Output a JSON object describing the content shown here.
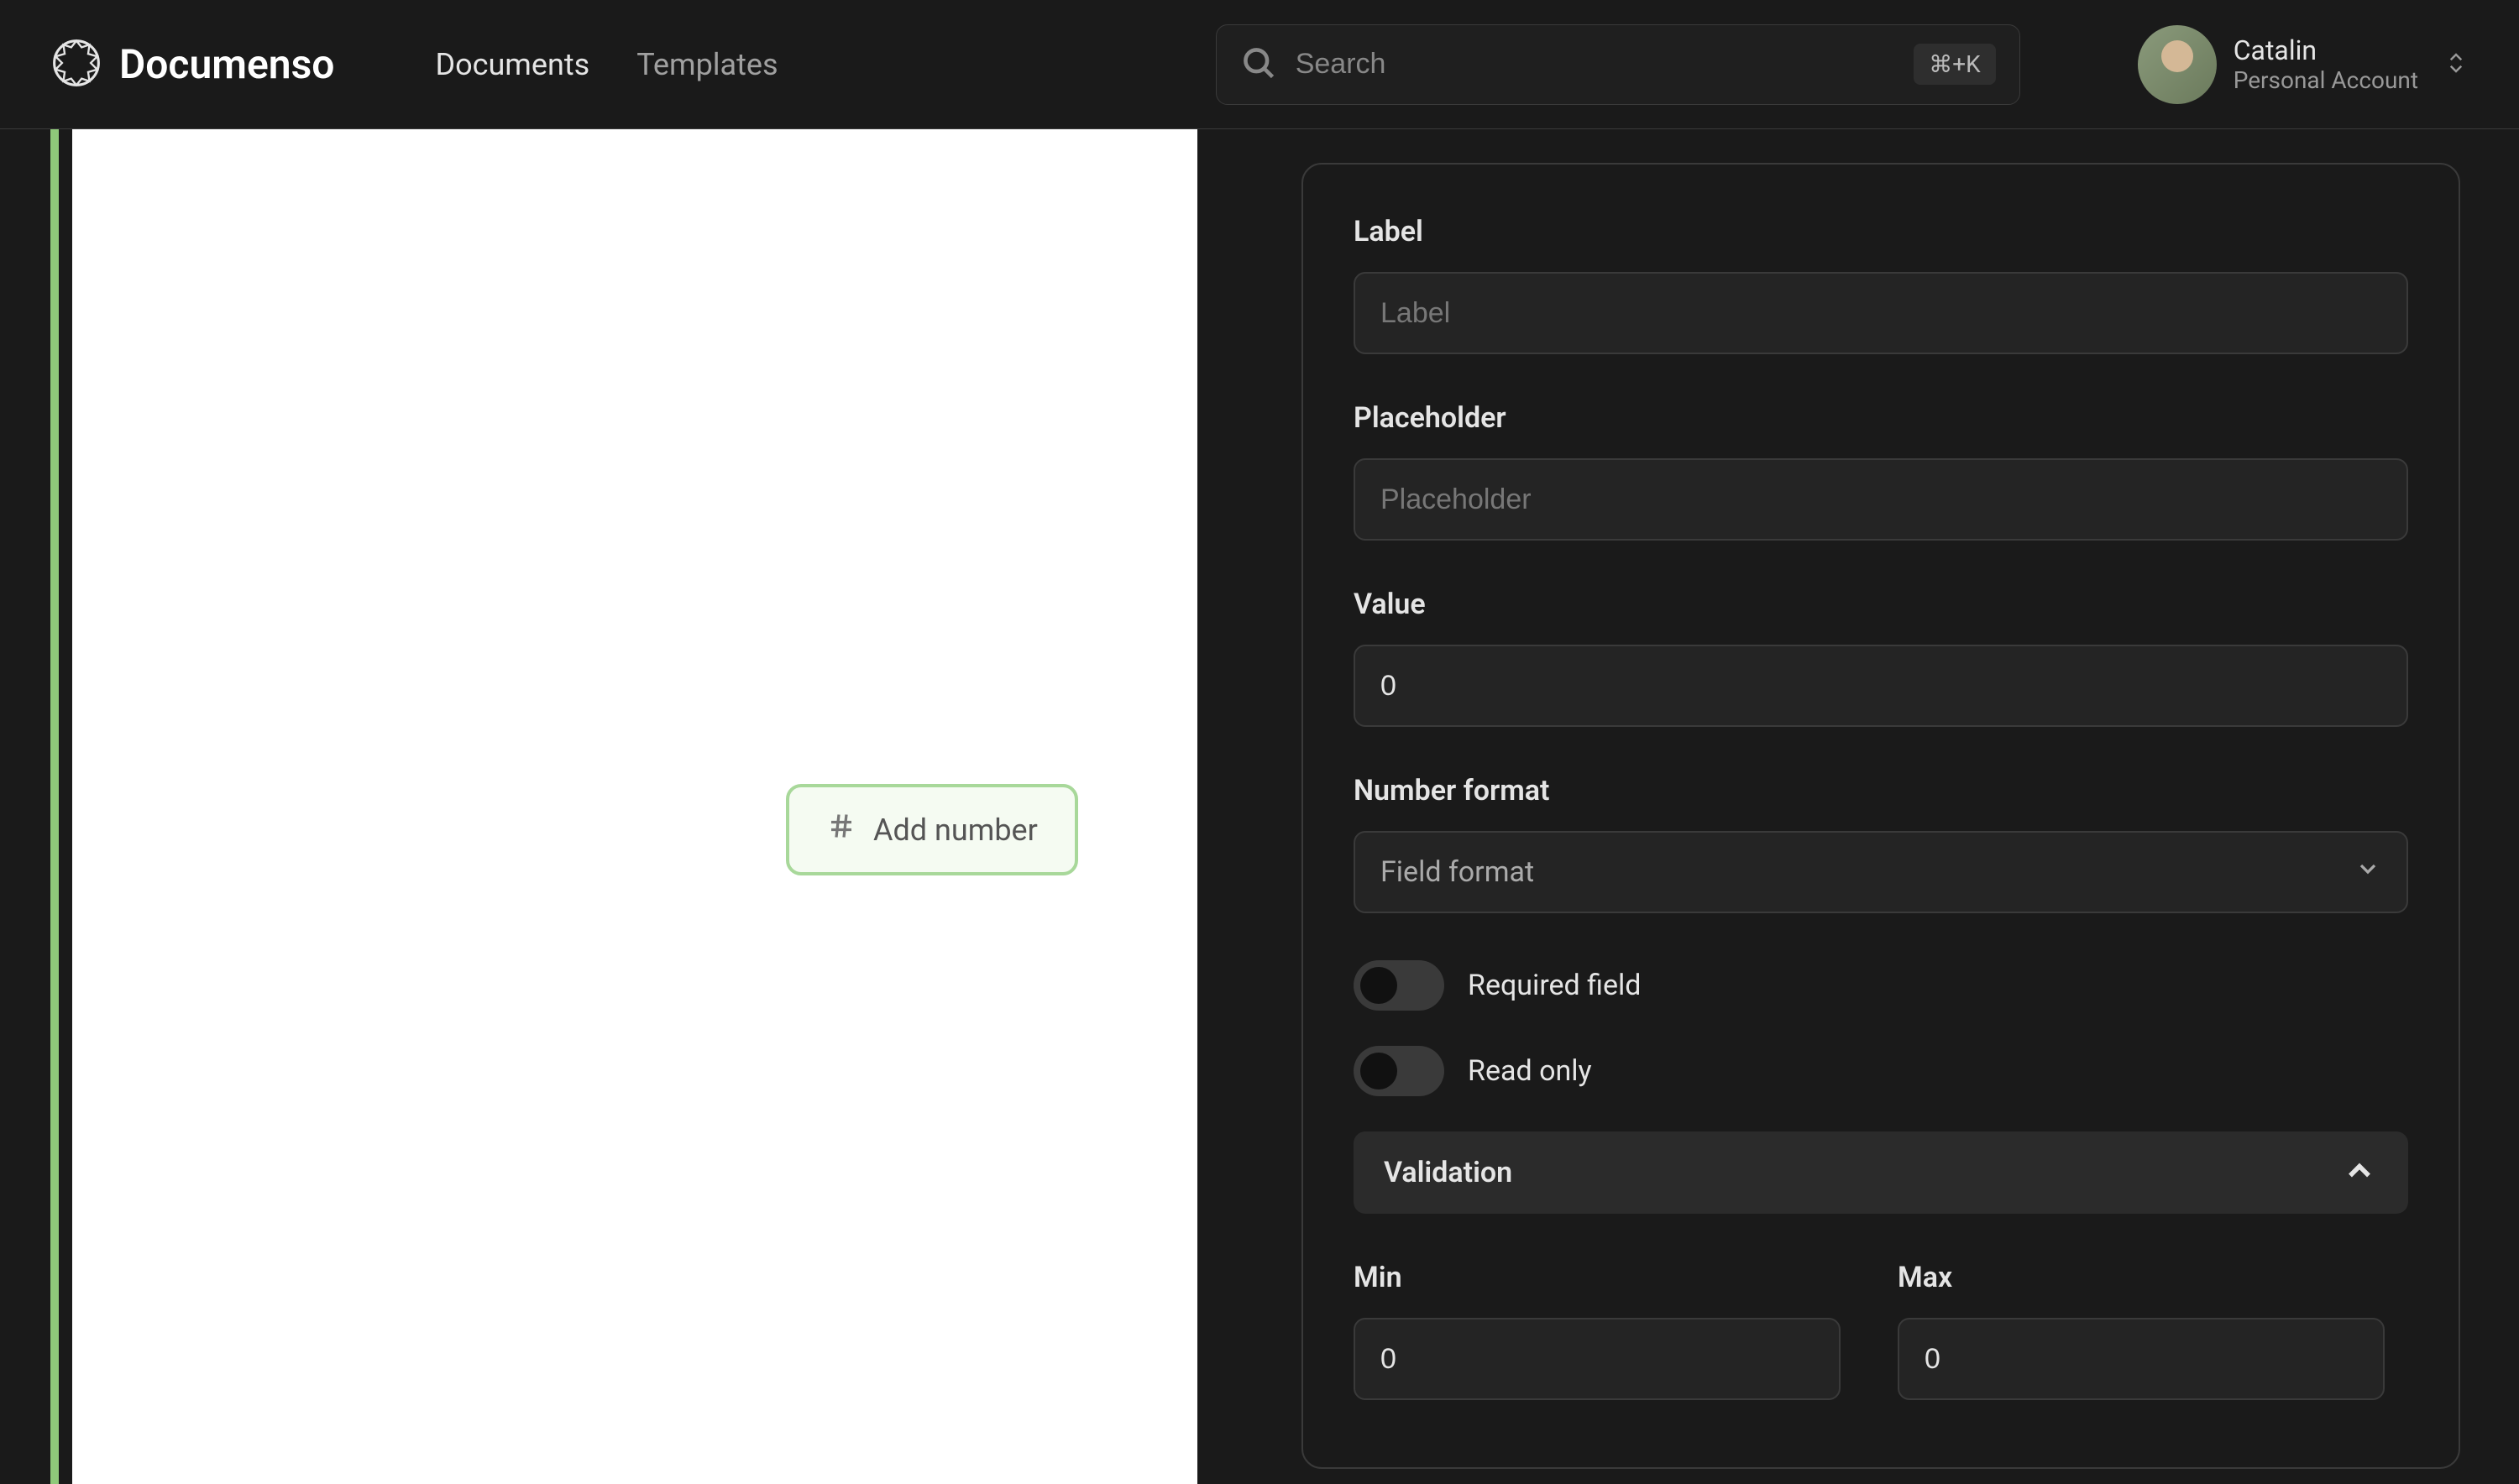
{
  "header": {
    "brand": "Documenso",
    "nav": {
      "documents": "Documents",
      "templates": "Templates"
    },
    "search": {
      "placeholder": "Search",
      "shortcut": "⌘+K"
    },
    "user": {
      "name": "Catalin",
      "account": "Personal Account"
    }
  },
  "doc": {
    "add_number_label": "Add number"
  },
  "panel": {
    "label": {
      "title": "Label",
      "placeholder": "Label"
    },
    "placeholder": {
      "title": "Placeholder",
      "placeholder": "Placeholder"
    },
    "value": {
      "title": "Value",
      "value": "0"
    },
    "number_format": {
      "title": "Number format",
      "select_text": "Field format"
    },
    "required_field": "Required field",
    "read_only": "Read only",
    "validation": {
      "title": "Validation",
      "min_label": "Min",
      "max_label": "Max",
      "min_value": "0",
      "max_value": "0"
    }
  }
}
